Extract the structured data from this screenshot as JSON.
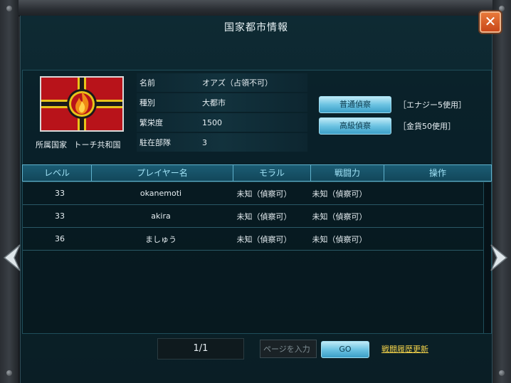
{
  "window": {
    "title": "国家都市情報",
    "close_symbol": "✕"
  },
  "city": {
    "fields": [
      {
        "key": "名前",
        "value": "オアズ（占領不可）"
      },
      {
        "key": "種別",
        "value": "大都市"
      },
      {
        "key": "繁栄度",
        "value": "1500"
      },
      {
        "key": "駐在部隊",
        "value": "3"
      }
    ],
    "nation_label": "所属国家",
    "nation_name": "トーチ共和国",
    "flag_colors": {
      "field": "#b8131a",
      "cross": "#1a1a1a",
      "trim": "#e8c31a",
      "flame": "#f08a14"
    }
  },
  "scout": {
    "normal_label": "普通偵察",
    "normal_cost": "［エナジー5使用］",
    "advanced_label": "高級偵察",
    "advanced_cost": "［金貨50使用］"
  },
  "table": {
    "headers": [
      "レベル",
      "プレイヤー名",
      "モラル",
      "戦闘力",
      "操作"
    ],
    "rows": [
      {
        "level": "33",
        "player": "okanemoti",
        "morale": "未知（偵察可）",
        "power": "未知（偵察可）",
        "action": ""
      },
      {
        "level": "33",
        "player": "akira",
        "morale": "未知（偵察可）",
        "power": "未知（偵察可）",
        "action": ""
      },
      {
        "level": "36",
        "player": "ましゅう",
        "morale": "未知（偵察可）",
        "power": "未知（偵察可）",
        "action": ""
      }
    ]
  },
  "pagination": {
    "display": "1/1",
    "input_placeholder": "ページを入力",
    "go_label": "GO",
    "history_label": "戦闘履歴更新"
  },
  "icons": {
    "close": "close-icon",
    "prev": "chevron-left-icon",
    "next": "chevron-right-icon"
  },
  "colors": {
    "accent": "#5fb1cc",
    "header_text": "#9fe1f5",
    "link": "#f2d24a",
    "close": "#d85a24"
  }
}
